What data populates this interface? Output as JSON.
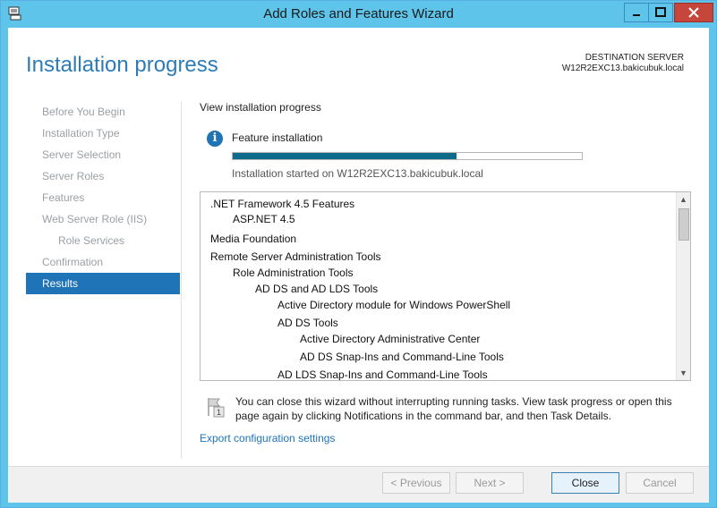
{
  "window": {
    "title": "Add Roles and Features Wizard"
  },
  "header": {
    "page_title": "Installation progress",
    "destination_label": "DESTINATION SERVER",
    "destination_server": "W12R2EXC13.bakicubuk.local"
  },
  "steps": [
    {
      "label": "Before You Begin",
      "state": "disabled"
    },
    {
      "label": "Installation Type",
      "state": "disabled"
    },
    {
      "label": "Server Selection",
      "state": "disabled"
    },
    {
      "label": "Server Roles",
      "state": "disabled"
    },
    {
      "label": "Features",
      "state": "disabled"
    },
    {
      "label": "Web Server Role (IIS)",
      "state": "disabled"
    },
    {
      "label": "Role Services",
      "state": "disabled",
      "sub": true
    },
    {
      "label": "Confirmation",
      "state": "disabled"
    },
    {
      "label": "Results",
      "state": "active"
    }
  ],
  "main": {
    "view_label": "View installation progress",
    "feature_label": "Feature installation",
    "progress_fraction": 0.64,
    "started_text": "Installation started on W12R2EXC13.bakicubuk.local",
    "items": [
      {
        "text": ".NET Framework 4.5 Features",
        "indent": 0
      },
      {
        "text": "ASP.NET 4.5",
        "indent": 1
      },
      {
        "text": "Media Foundation",
        "indent": 0
      },
      {
        "text": "Remote Server Administration Tools",
        "indent": 0
      },
      {
        "text": "Role Administration Tools",
        "indent": 1
      },
      {
        "text": "AD DS and AD LDS Tools",
        "indent": 2
      },
      {
        "text": "Active Directory module for Windows PowerShell",
        "indent": 3
      },
      {
        "text": "AD DS Tools",
        "indent": 3
      },
      {
        "text": "Active Directory Administrative Center",
        "indent": 4
      },
      {
        "text": "AD DS Snap-Ins and Command-Line Tools",
        "indent": 4
      },
      {
        "text": "AD LDS Snap-Ins and Command-Line Tools",
        "indent": 3
      }
    ],
    "note_line1": "You can close this wizard without interrupting running tasks. View task progress or open this",
    "note_line2": "page again by clicking Notifications in the command bar, and then Task Details.",
    "flag_count": "1",
    "export_link": "Export configuration settings"
  },
  "footer": {
    "previous": "< Previous",
    "next": "Next >",
    "close": "Close",
    "cancel": "Cancel"
  },
  "colors": {
    "title_bar": "#5ec4ea",
    "accent": "#1f73b7",
    "progress": "#0f6b8a",
    "close_button": "#c7463c"
  }
}
